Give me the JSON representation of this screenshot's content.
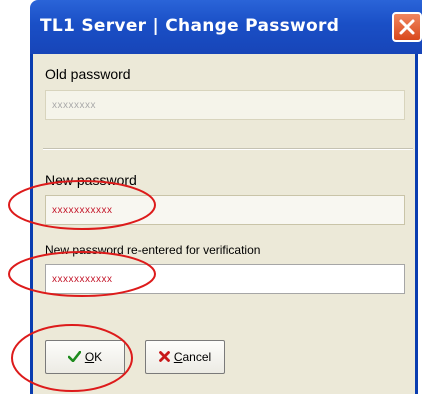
{
  "window": {
    "title": "TL1 Server | Change Password",
    "close_icon": "close-icon",
    "title_bar_color": "#1a4fc6",
    "close_color": "#e05a2b"
  },
  "form": {
    "old_password_label": "Old password",
    "old_password_value": "xxxxxxxx",
    "new_password_label": "New password",
    "new_password_value": "xxxxxxxxxxx",
    "confirm_label": "New password re-entered for verification",
    "confirm_value": "xxxxxxxxxxx"
  },
  "buttons": {
    "ok_icon": "checkmark-icon",
    "ok_label_underlined": "O",
    "ok_label_rest": "K",
    "cancel_icon": "x-icon",
    "cancel_label_underlined": "C",
    "cancel_label_rest": "ancel"
  },
  "annotations": {
    "color": "#dd1b1b",
    "count": 3
  }
}
